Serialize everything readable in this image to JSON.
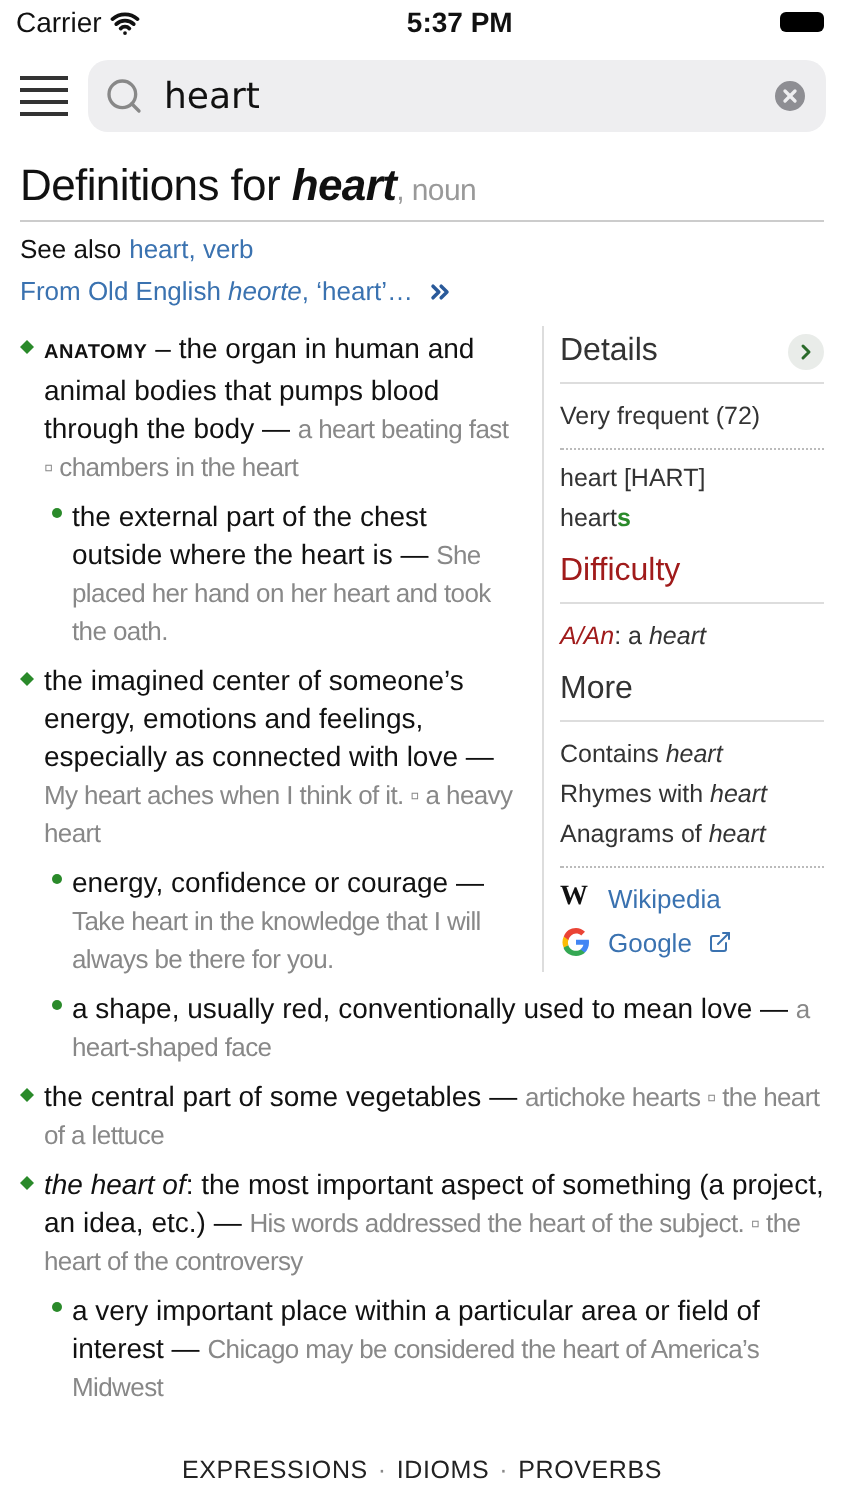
{
  "status_bar": {
    "carrier": "Carrier",
    "time": "5:37 PM"
  },
  "search": {
    "value": "heart"
  },
  "heading": {
    "prefix": "Definitions for",
    "word": "heart",
    "pos": ", noun"
  },
  "see_also": {
    "label": "See also",
    "link": "heart, verb"
  },
  "etymology": "From Old English *heorte*, ‘heart’…",
  "details": {
    "title": "Details",
    "frequency": "Very frequent (72)",
    "pronunciation": "heart [HART]",
    "plural": {
      "base": "heart",
      "suffix": "s"
    }
  },
  "difficulty": {
    "title": "Difficulty",
    "label": "A/An",
    "value": ": a *heart*"
  },
  "more": {
    "title": "More",
    "links": [
      "Contains *heart*",
      "Rhymes with *heart*",
      "Anagrams of *heart*"
    ]
  },
  "dash": "—",
  "label_dash": "–",
  "external_links": [
    {
      "kind": "wikipedia",
      "label": "Wikipedia",
      "icon_text": "W",
      "external": false
    },
    {
      "kind": "google",
      "label": "Google",
      "external": true
    }
  ],
  "definitions": [
    {
      "label": "ANATOMY",
      "text": "the organ in human and animal bodies that pumps blood through the body",
      "examples": "a heart beating fast ▫ chambers in the heart",
      "children": [
        {
          "text": "the external part of the chest outside where the heart is",
          "examples": "She placed her hand on her heart and took the oath."
        }
      ]
    },
    {
      "text": "the imagined center of someone’s energy, emotions and feelings, especially as connected with love",
      "examples": "My heart aches when I think of it. ▫ a heavy heart",
      "children": [
        {
          "text": "energy, confidence or courage",
          "examples": "Take heart in the knowledge that I will always be there for you."
        },
        {
          "text": "a shape, usually red, conventionally used to mean love",
          "examples": "a heart-shaped face"
        }
      ]
    },
    {
      "text": "the central part of some vegetables",
      "examples": "artichoke hearts ▫ the heart of a lettuce"
    },
    {
      "text": "*the heart of*: the most important aspect of something (a project, an idea, etc.)",
      "examples": "His words addressed the heart of the subject. ▫ the heart of the controversy",
      "children": [
        {
          "text": "a very important place within a particular area or field of interest",
          "examples": "Chicago may be considered the heart of America’s Midwest"
        }
      ]
    }
  ],
  "footer": {
    "separator": "·",
    "links": [
      "EXPRESSIONS",
      "IDIOMS",
      "PROVERBS"
    ]
  }
}
